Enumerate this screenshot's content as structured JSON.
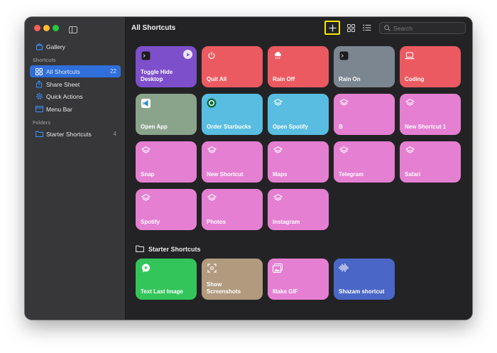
{
  "sidebar": {
    "gallery": "Gallery",
    "shortcuts_section": "Shortcuts",
    "items": [
      {
        "label": "All Shortcuts",
        "count": "22"
      },
      {
        "label": "Share Sheet"
      },
      {
        "label": "Quick Actions"
      },
      {
        "label": "Menu Bar"
      }
    ],
    "folders_section": "Folders",
    "folders": [
      {
        "label": "Starter Shortcuts",
        "count": "4"
      }
    ]
  },
  "header": {
    "title": "All Shortcuts",
    "search_placeholder": "Search"
  },
  "shortcuts": [
    {
      "label": "Toggle Hide\nDesktop",
      "color": "#7e4fcb",
      "icon": "terminal-icon"
    },
    {
      "label": "Quit All",
      "color": "#ec5a61",
      "icon": "power-icon"
    },
    {
      "label": "Rain Off",
      "color": "#ec5a61",
      "icon": "cloud-rain-icon"
    },
    {
      "label": "Rain On",
      "color": "#7c8691",
      "icon": "terminal-icon"
    },
    {
      "label": "Coding",
      "color": "#ec5a61",
      "icon": "laptop-icon"
    },
    {
      "label": "Open App",
      "color": "#8aa48c",
      "icon": "vscode-icon"
    },
    {
      "label": "Order Starbucks",
      "color": "#58bde0",
      "icon": "starbucks-icon"
    },
    {
      "label": "Open Spotify",
      "color": "#58bde0",
      "icon": "layers-icon"
    },
    {
      "label": "B",
      "color": "#e57fd2",
      "icon": "layers-icon"
    },
    {
      "label": "New Shortcut 1",
      "color": "#e57fd2",
      "icon": "layers-icon"
    },
    {
      "label": "Snap",
      "color": "#e57fd2",
      "icon": "layers-icon"
    },
    {
      "label": "New Shortcut",
      "color": "#e57fd2",
      "icon": "layers-icon"
    },
    {
      "label": "Maps",
      "color": "#e57fd2",
      "icon": "layers-icon"
    },
    {
      "label": "Telegram",
      "color": "#e57fd2",
      "icon": "layers-icon"
    },
    {
      "label": "Safari",
      "color": "#e57fd2",
      "icon": "layers-icon"
    },
    {
      "label": "Spotify",
      "color": "#e57fd2",
      "icon": "layers-icon"
    },
    {
      "label": "Photos",
      "color": "#e57fd2",
      "icon": "layers-icon"
    },
    {
      "label": "Instagram",
      "color": "#e57fd2",
      "icon": "layers-icon"
    }
  ],
  "starter": {
    "title": "Starter Shortcuts",
    "items": [
      {
        "label": "Text Last Image",
        "color": "#33c55a",
        "icon": "message-icon"
      },
      {
        "label": "Show\nScreenshots",
        "color": "#b29a7e",
        "icon": "screenshot-icon"
      },
      {
        "label": "Make GIF",
        "color": "#e57fd2",
        "icon": "photos-icon"
      },
      {
        "label": "Shazam shortcut",
        "color": "#4a67c7",
        "icon": "waveform-icon"
      }
    ]
  }
}
